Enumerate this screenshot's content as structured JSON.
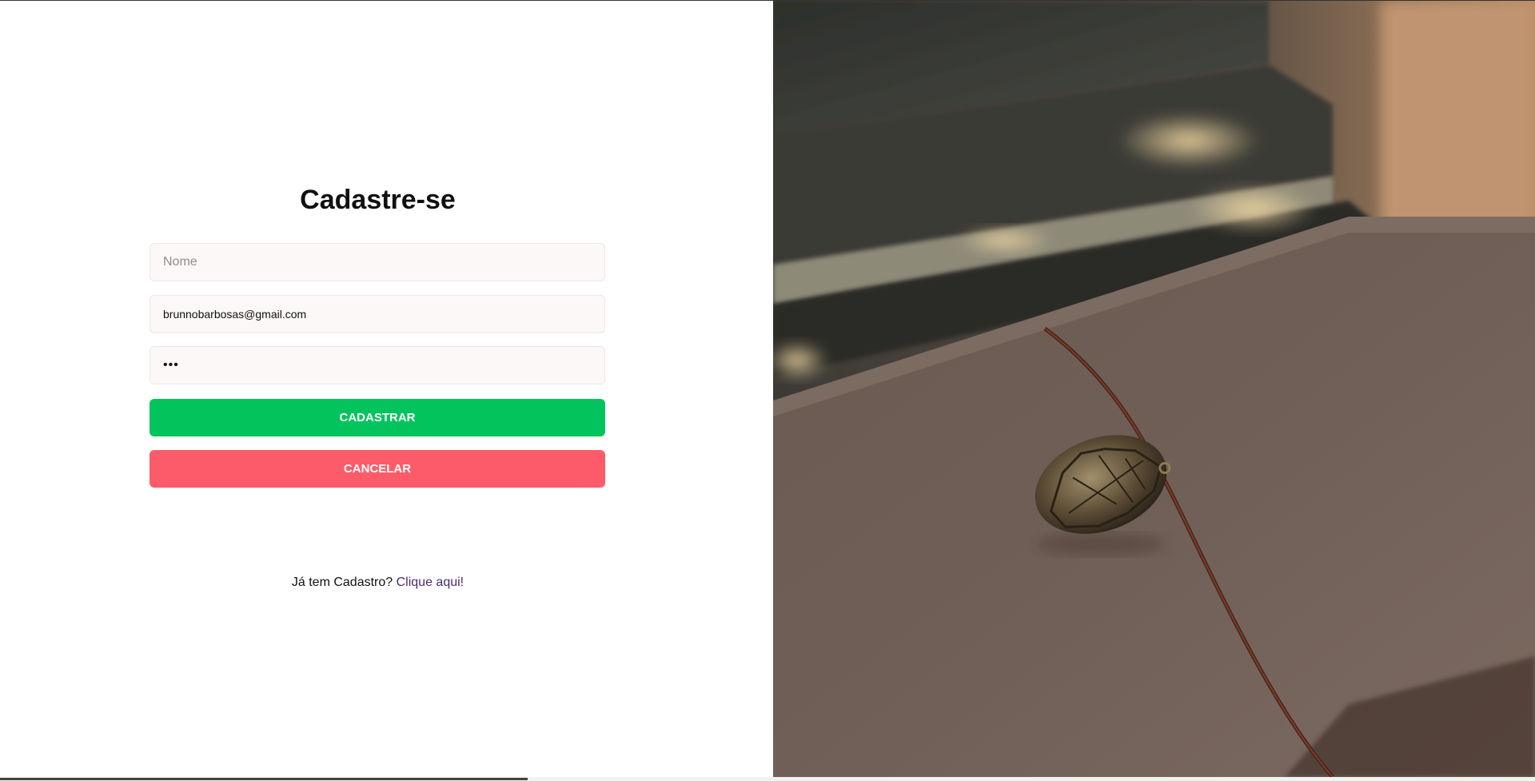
{
  "form": {
    "title": "Cadastre-se",
    "name_placeholder": "Nome",
    "name_value": "",
    "email_value": "brunnobarbosas@gmail.com",
    "password_value": "123",
    "register_label": "CADASTRAR",
    "cancel_label": "CANCELAR"
  },
  "login_prompt": {
    "text": "Já tem Cadastro?",
    "link_label": "Clique aqui!"
  },
  "colors": {
    "register_button": "#03c45c",
    "cancel_button": "#fc5c69",
    "link": "#4a2a70",
    "input_background": "#fcf8f7"
  },
  "hero_image": {
    "icon": "leather-notebook-photo"
  }
}
